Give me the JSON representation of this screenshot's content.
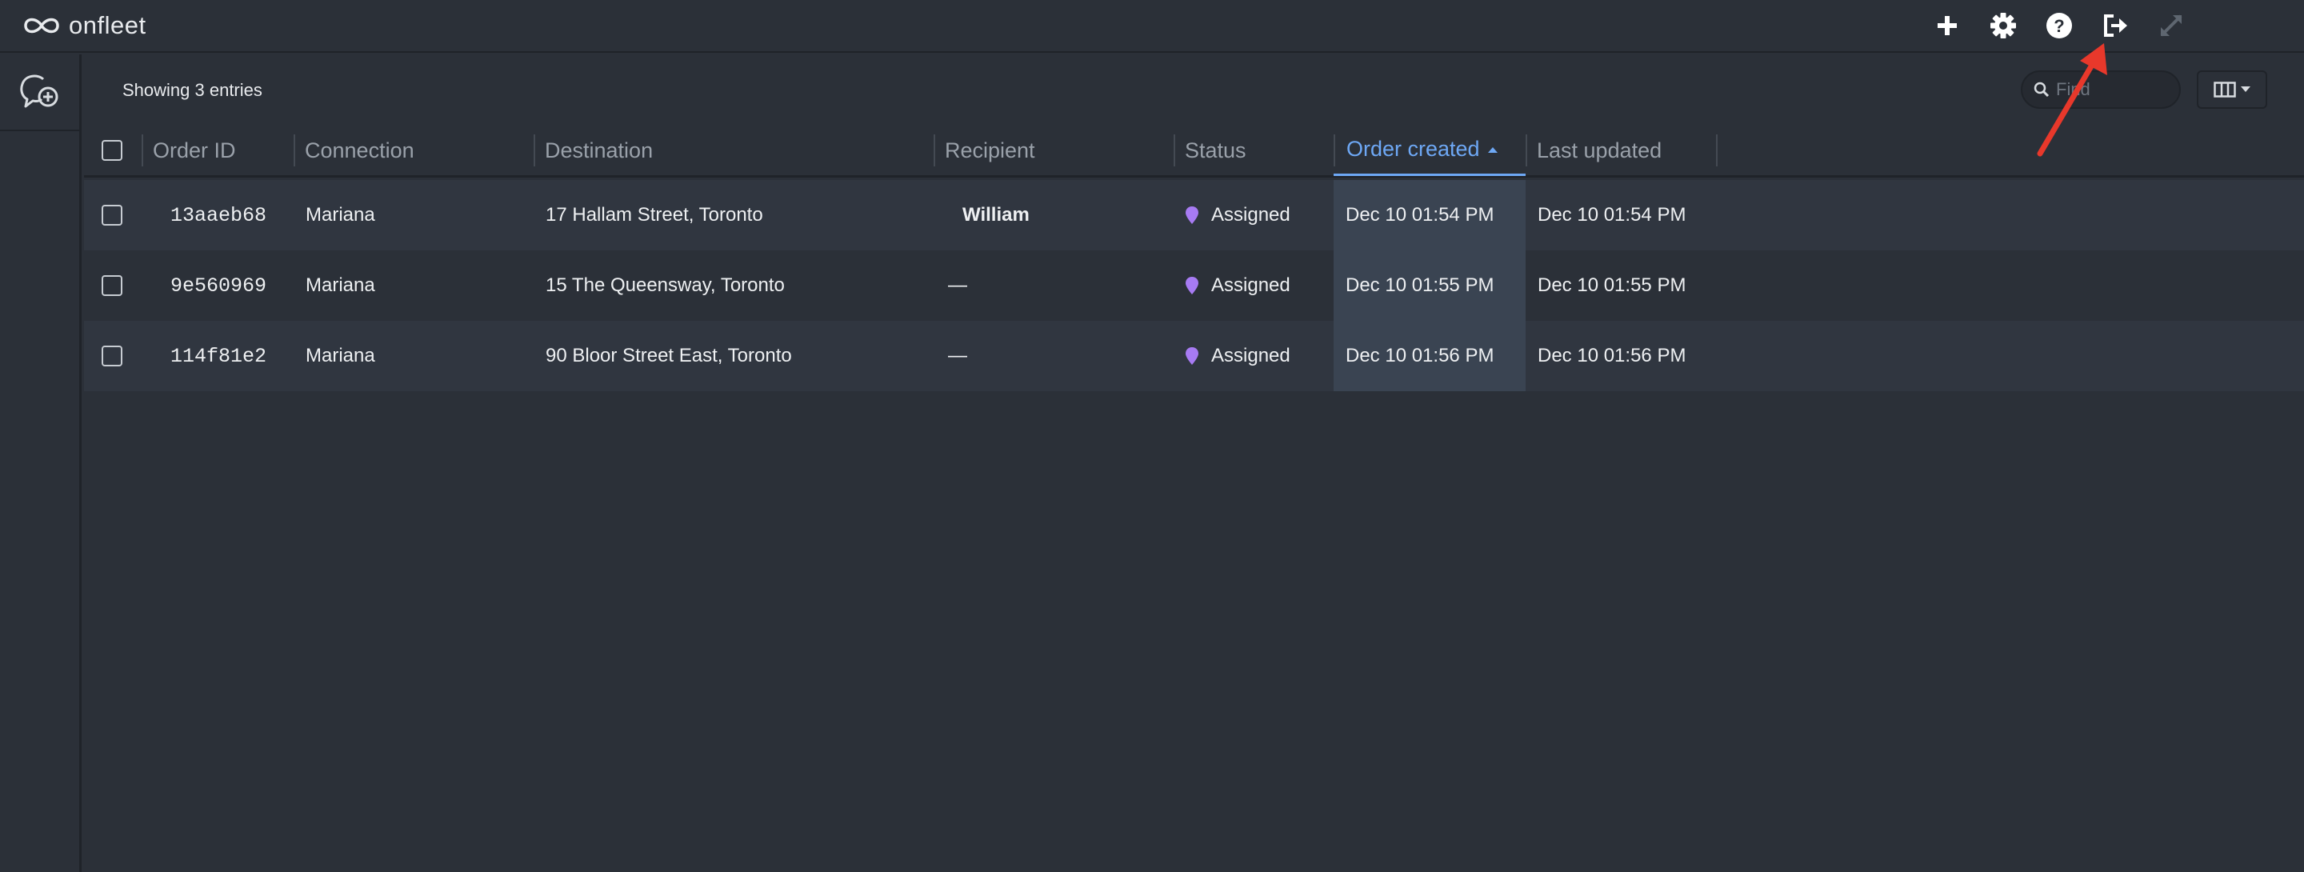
{
  "app": {
    "logo_text": "onfleet"
  },
  "topbar": {
    "icons": [
      "add-icon",
      "gear-icon",
      "help-icon",
      "logout-icon",
      "expand-icon"
    ]
  },
  "toolbar": {
    "entries_text": "Showing 3 entries",
    "find_placeholder": "Find"
  },
  "table": {
    "columns": [
      "Order ID",
      "Connection",
      "Destination",
      "Recipient",
      "Status",
      "Order created",
      "Last updated"
    ],
    "sorted_column": "Order created",
    "rows": [
      {
        "order_id": "13aaeb68",
        "connection": "Mariana",
        "destination": "17 Hallam Street, Toronto",
        "recipient": "William",
        "status": "Assigned",
        "order_created": "Dec 10 01:54 PM",
        "last_updated": "Dec 10 01:54 PM"
      },
      {
        "order_id": "9e560969",
        "connection": "Mariana",
        "destination": "15 The Queensway, Toronto",
        "recipient": "—",
        "status": "Assigned",
        "order_created": "Dec 10 01:55 PM",
        "last_updated": "Dec 10 01:55 PM"
      },
      {
        "order_id": "114f81e2",
        "connection": "Mariana",
        "destination": "90 Bloor Street East, Toronto",
        "recipient": "—",
        "status": "Assigned",
        "order_created": "Dec 10 01:56 PM",
        "last_updated": "Dec 10 01:56 PM"
      }
    ]
  },
  "colors": {
    "background": "#2b3038",
    "accent": "#6ea8f5",
    "status_assigned": "#a77bf3",
    "annotation_arrow": "#e8382b"
  }
}
